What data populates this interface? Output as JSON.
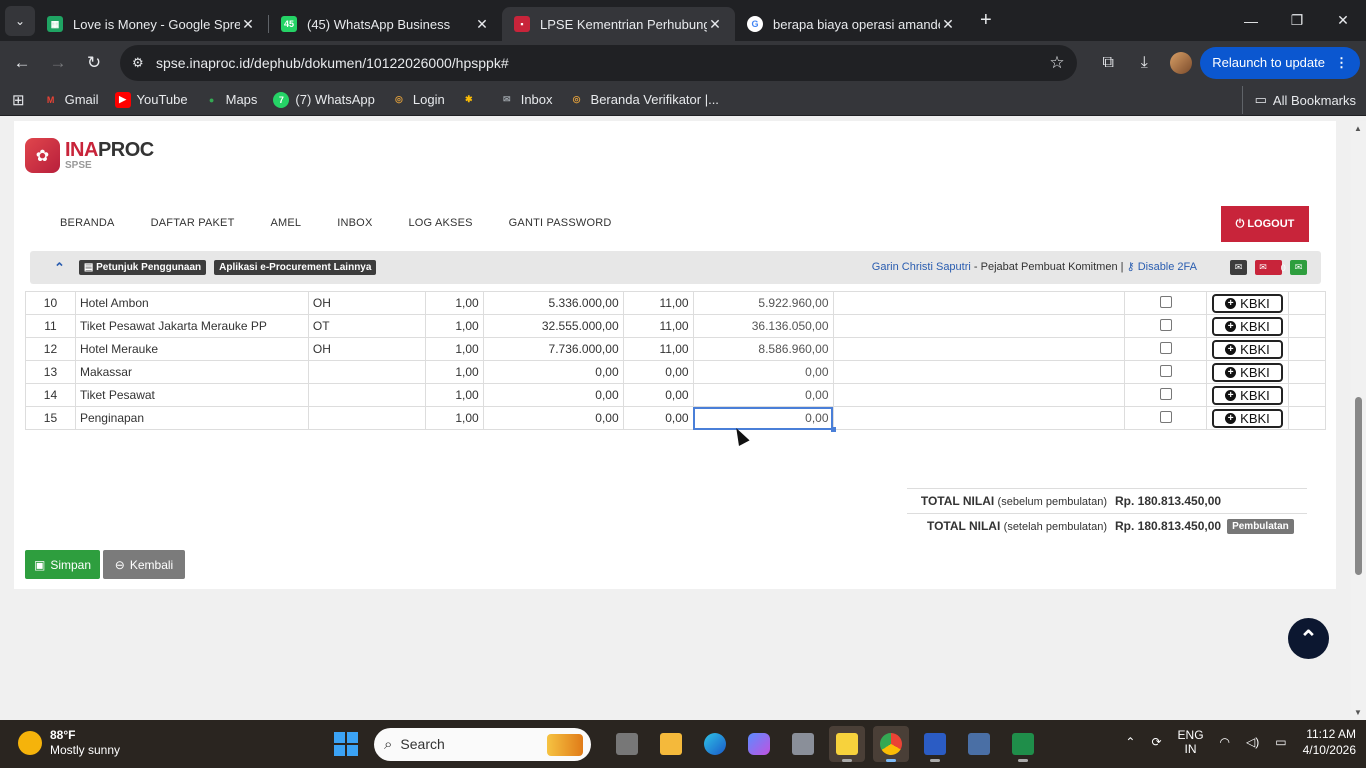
{
  "browser": {
    "tabs": [
      {
        "title": "Love is Money - Google Spread",
        "favicon_color": "#1fa463",
        "active": false
      },
      {
        "title": "(45) WhatsApp Business",
        "favicon_color": "#25d366",
        "favicon_text": "45",
        "active": false
      },
      {
        "title": "LPSE Kementrian Perhubungan",
        "favicon_color": "#c8243a",
        "active": true
      },
      {
        "title": "berapa biaya operasi amandel -",
        "favicon_color": "#ffffff",
        "active": false
      }
    ],
    "url": "spse.inaproc.id/dephub/dokumen/10122026000/hpsppk#",
    "relaunch_label": "Relaunch to update",
    "bookmarks": [
      {
        "label": "Gmail",
        "color": "#ea4335"
      },
      {
        "label": "YouTube",
        "color": "#ff0000"
      },
      {
        "label": "Maps",
        "color": "#34a853"
      },
      {
        "label": "(7) WhatsApp",
        "color": "#25d366"
      },
      {
        "label": "Login",
        "color": "#8e44ad"
      },
      {
        "label": "",
        "color": "#fbbc05"
      },
      {
        "label": "Inbox",
        "color": "#9aa0a6"
      },
      {
        "label": "Beranda Verifikator |...",
        "color": "#8e44ad"
      }
    ],
    "all_bookmarks": "All Bookmarks"
  },
  "site": {
    "logo_ina": "INA",
    "logo_proc": "PROC",
    "logo_sub": "SPSE",
    "nav": [
      "BERANDA",
      "DAFTAR PAKET",
      "AMEL",
      "INBOX",
      "LOG AKSES",
      "GANTI PASSWORD"
    ],
    "logout": "LOGOUT",
    "petunjuk": "Petunjuk Penggunaan",
    "aplikasi": "Aplikasi e-Procurement Lainnya",
    "user_name": "Garin Christi Saputri",
    "user_role": " - Pejabat Pembuat Komitmen | ",
    "disable_2fa": "Disable 2FA",
    "inbox_count": "0"
  },
  "table": {
    "rows": [
      {
        "no": "10",
        "nama": "Hotel Ambon",
        "satuan": "OH",
        "volume": "1,00",
        "harga": "5.336.000,00",
        "pajak": "11,00",
        "total": "5.922.960,00"
      },
      {
        "no": "11",
        "nama": "Tiket Pesawat Jakarta Merauke PP",
        "satuan": "OT",
        "volume": "1,00",
        "harga": "32.555.000,00",
        "pajak": "11,00",
        "total": "36.136.050,00"
      },
      {
        "no": "12",
        "nama": "Hotel Merauke",
        "satuan": "OH",
        "volume": "1,00",
        "harga": "7.736.000,00",
        "pajak": "11,00",
        "total": "8.586.960,00"
      },
      {
        "no": "13",
        "nama": "Makassar",
        "satuan": "",
        "volume": "1,00",
        "harga": "0,00",
        "pajak": "0,00",
        "total": "0,00"
      },
      {
        "no": "14",
        "nama": "Tiket Pesawat",
        "satuan": "",
        "volume": "1,00",
        "harga": "0,00",
        "pajak": "0,00",
        "total": "0,00"
      },
      {
        "no": "15",
        "nama": "Penginapan",
        "satuan": "",
        "volume": "1,00",
        "harga": "0,00",
        "pajak": "0,00",
        "total": "0,00"
      }
    ],
    "kbki_label": "KBKI"
  },
  "totals": {
    "label_main": "TOTAL NILAI",
    "before_note": "(sebelum pembulatan)",
    "after_note": "(setelah pembulatan)",
    "before_value": "Rp. 180.813.450,00",
    "after_value": "Rp. 180.813.450,00",
    "pembulatan": "Pembulatan"
  },
  "buttons": {
    "simpan": "Simpan",
    "kembali": "Kembali"
  },
  "taskbar": {
    "temp": "88°F",
    "weather": "Mostly sunny",
    "search": "Search",
    "lang1": "ENG",
    "lang2": "IN",
    "time": "11:12 AM",
    "date": "4/10/2026"
  }
}
